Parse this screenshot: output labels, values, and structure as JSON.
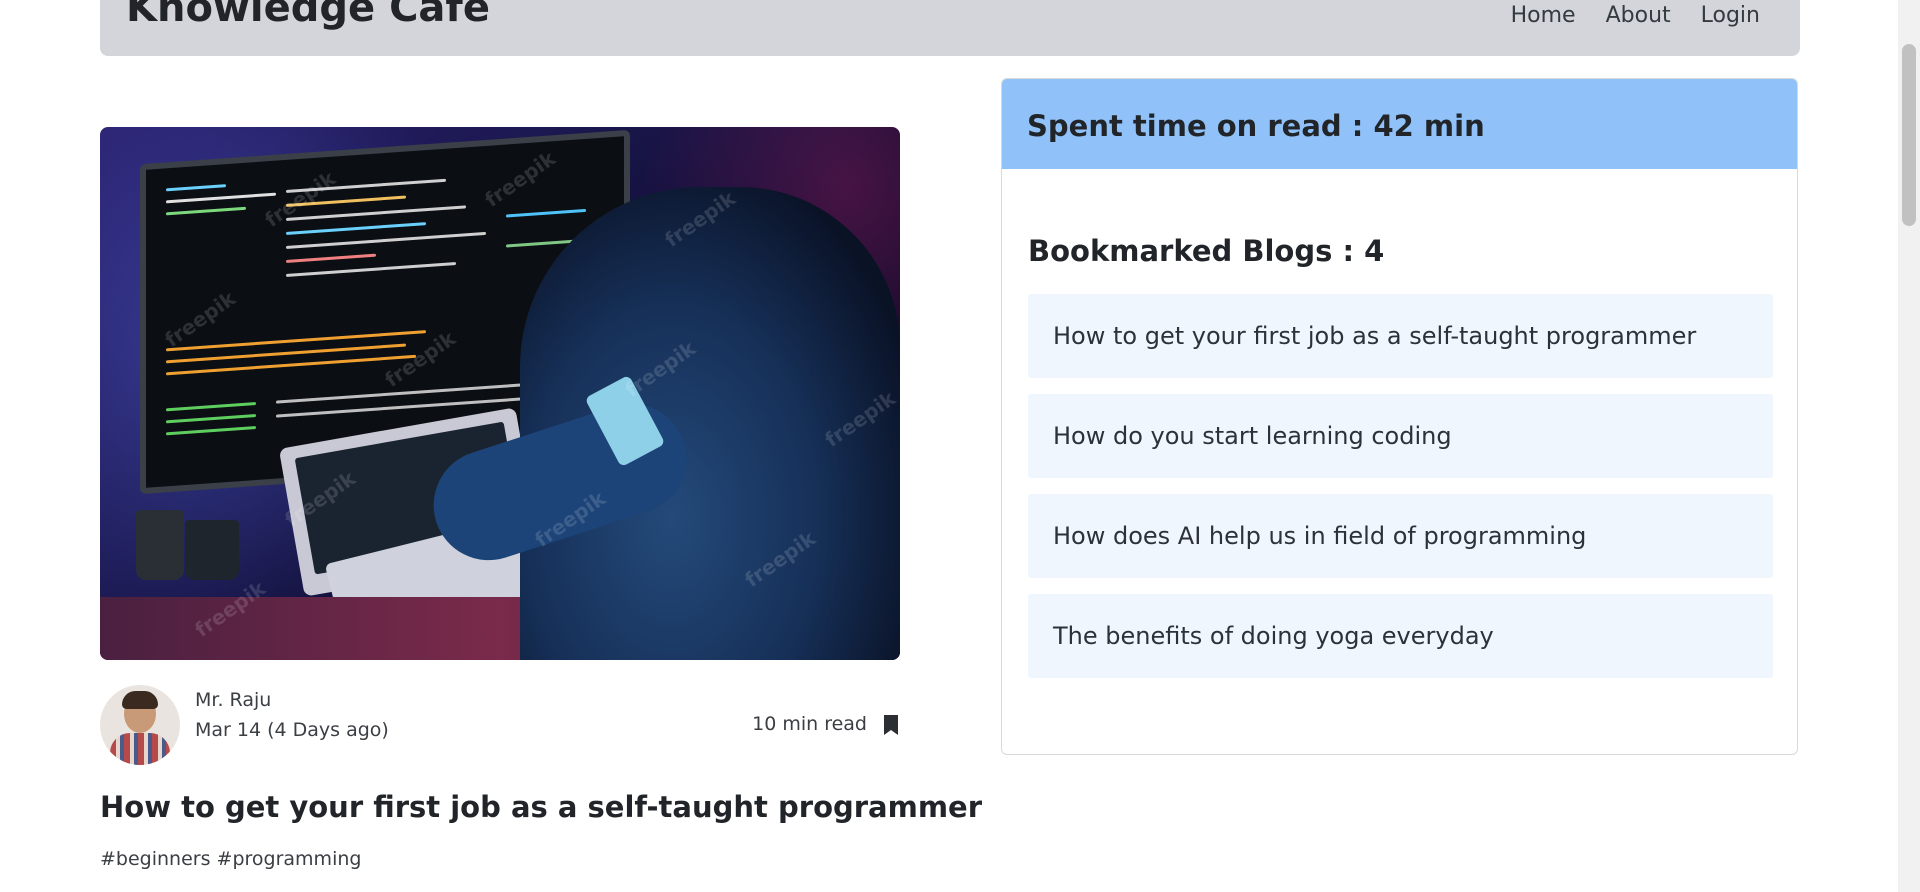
{
  "header": {
    "brand": "Knowledge Cafe",
    "nav": {
      "home": "Home",
      "about": "About",
      "login": "Login"
    }
  },
  "blog": {
    "image_watermark": "freepik",
    "author": "Mr. Raju",
    "date": "Mar 14 (4 Days ago)",
    "read_time": "10 min read",
    "title": "How to get your first job as a self-taught programmer",
    "tags": "#beginners #programming",
    "icons": {
      "bookmark": "bookmark-icon"
    }
  },
  "sidebar": {
    "spent_time": "Spent time on read : 42 min",
    "bookmarks_title": "Bookmarked Blogs : 4",
    "bookmarks": [
      "How to get your first job as a self-taught programmer",
      "How do you start learning coding",
      "How does AI help us in field of programming",
      "The benefits of doing yoga everyday"
    ]
  },
  "colors": {
    "navbar_bg": "#d3d5db",
    "spent_header_bg": "#90c2f9",
    "bookmark_item_bg": "#eff6fd",
    "text": "#212529"
  }
}
